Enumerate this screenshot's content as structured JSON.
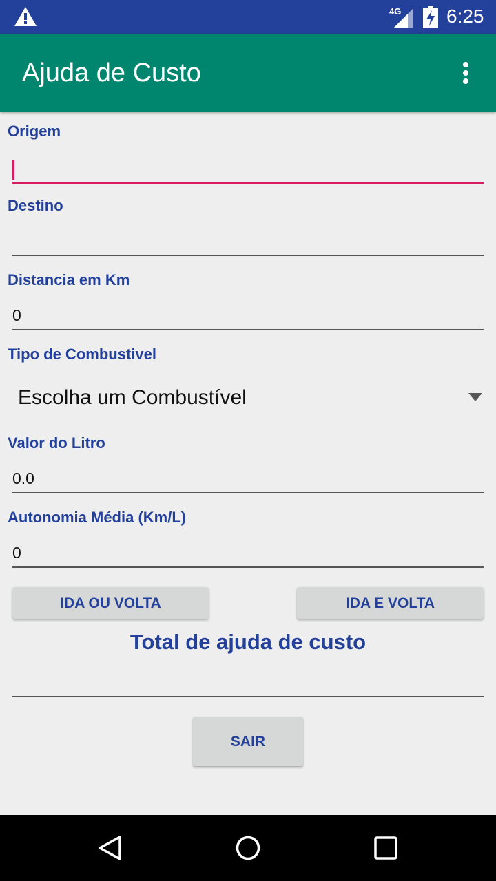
{
  "status_bar": {
    "network": "4G",
    "time": "6:25",
    "icons": [
      "warning-icon",
      "signal-icon",
      "battery-charging-icon"
    ]
  },
  "app_bar": {
    "title": "Ajuda de Custo",
    "menu_icon": "overflow-menu-icon"
  },
  "form": {
    "origem": {
      "label": "Origem",
      "value": ""
    },
    "destino": {
      "label": "Destino",
      "value": ""
    },
    "distancia": {
      "label": "Distancia em Km",
      "value": "0"
    },
    "combustivel": {
      "label": "Tipo de Combustivel",
      "selected": "Escolha um Combustível"
    },
    "valor_litro": {
      "label": "Valor do Litro",
      "value": "0.0"
    },
    "autonomia": {
      "label": "Autonomia Média (Km/L)",
      "value": "0"
    }
  },
  "buttons": {
    "ida_ou_volta": "IDA OU VOLTA",
    "ida_e_volta": "IDA E VOLTA",
    "sair": "SAIR"
  },
  "total": {
    "title": "Total de ajuda de custo",
    "value": ""
  },
  "nav_bar": {
    "icons": [
      "back-icon",
      "home-icon",
      "recents-icon"
    ]
  },
  "colors": {
    "status_bar": "#23409a",
    "app_bar": "#00856f",
    "accent": "#d81b60",
    "label_text": "#23409a"
  }
}
